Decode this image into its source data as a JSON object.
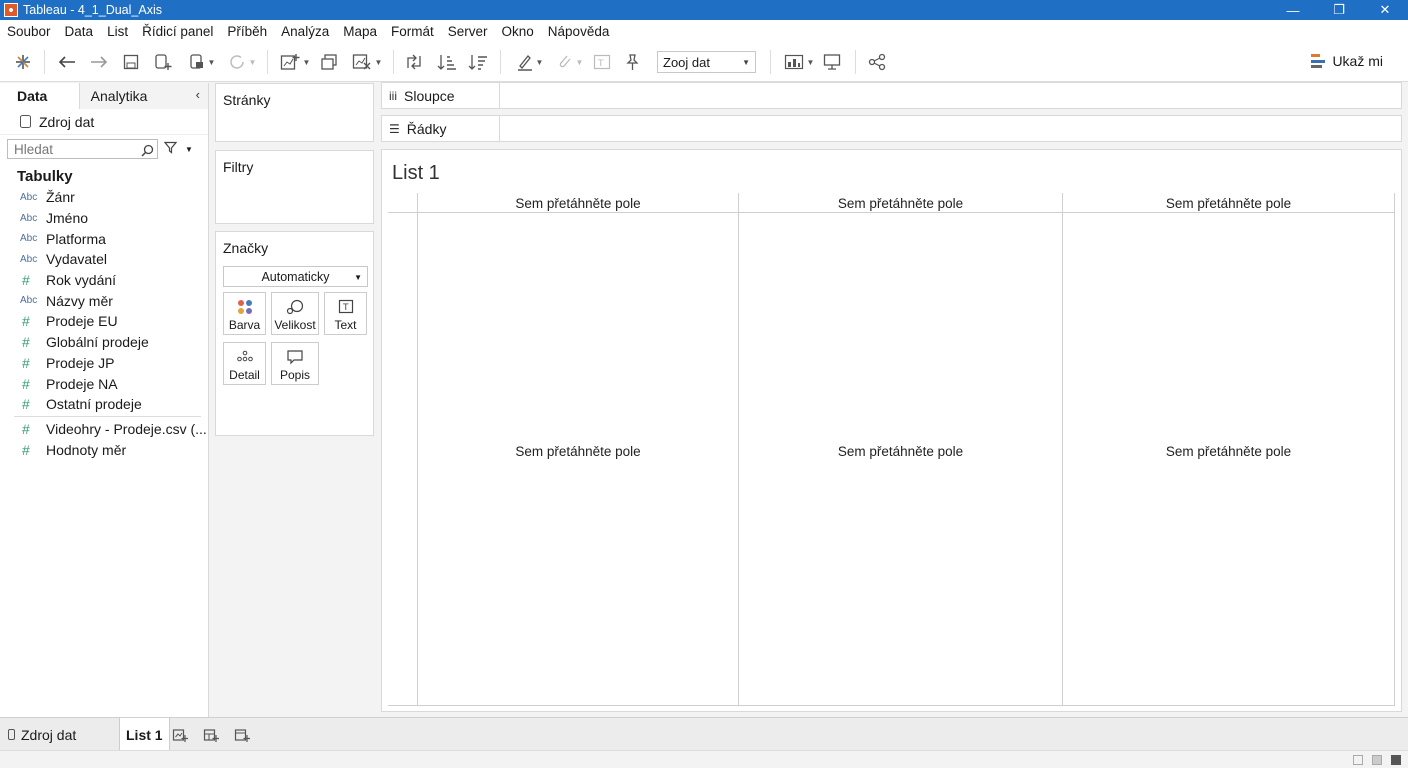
{
  "window": {
    "title": "Tableau - 4_1_Dual_Axis",
    "minimize": "—",
    "restore": "❐",
    "close": "✕"
  },
  "menu": [
    "Soubor",
    "Data",
    "List",
    "Řídicí panel",
    "Příběh",
    "Analýza",
    "Mapa",
    "Formát",
    "Server",
    "Okno",
    "Nápověda"
  ],
  "toolbar": {
    "fit_value": "Zooj dat",
    "show_me": "Ukaž mi"
  },
  "data_pane": {
    "tab_data": "Data",
    "tab_analytics": "Analytika",
    "collapse": "‹",
    "data_source": "Zdroj dat",
    "search_placeholder": "Hledat",
    "tables_heading": "Tabulky",
    "fields": [
      {
        "type": "Abc",
        "name": "Žánr"
      },
      {
        "type": "Abc",
        "name": "Jméno"
      },
      {
        "type": "Abc",
        "name": "Platforma"
      },
      {
        "type": "Abc",
        "name": "Vydavatel"
      },
      {
        "type": "#",
        "name": "Rok vydání"
      },
      {
        "type": "Abc",
        "name": "Názvy měr"
      },
      {
        "type": "#",
        "name": "Prodeje EU"
      },
      {
        "type": "#",
        "name": "Globální prodeje"
      },
      {
        "type": "#",
        "name": "Prodeje JP"
      },
      {
        "type": "#",
        "name": "Prodeje NA"
      },
      {
        "type": "#",
        "name": "Ostatní prodeje"
      }
    ],
    "extra_fields": [
      {
        "type": "#",
        "name": "Videohry - Prodeje.csv (..."
      },
      {
        "type": "#",
        "name": "Hodnoty měr"
      }
    ]
  },
  "cards": {
    "pages": "Stránky",
    "filters": "Filtry",
    "marks": "Značky",
    "mark_type": "Automaticky",
    "mark_buttons": {
      "color": "Barva",
      "size": "Velikost",
      "text": "Text",
      "detail": "Detail",
      "tooltip": "Popis"
    }
  },
  "shelves": {
    "columns": "Sloupce",
    "rows": "Řádky"
  },
  "view": {
    "sheet_title": "List 1",
    "drop_top": [
      "Sem přetáhněte pole",
      "Sem přetáhněte pole",
      "Sem přetáhněte pole"
    ],
    "drop_mid": [
      "Sem přetáhněte pole",
      "Sem přetáhněte pole",
      "Sem přetáhněte pole"
    ]
  },
  "bottom_tabs": {
    "data_source": "Zdroj dat",
    "sheet": "List 1"
  }
}
